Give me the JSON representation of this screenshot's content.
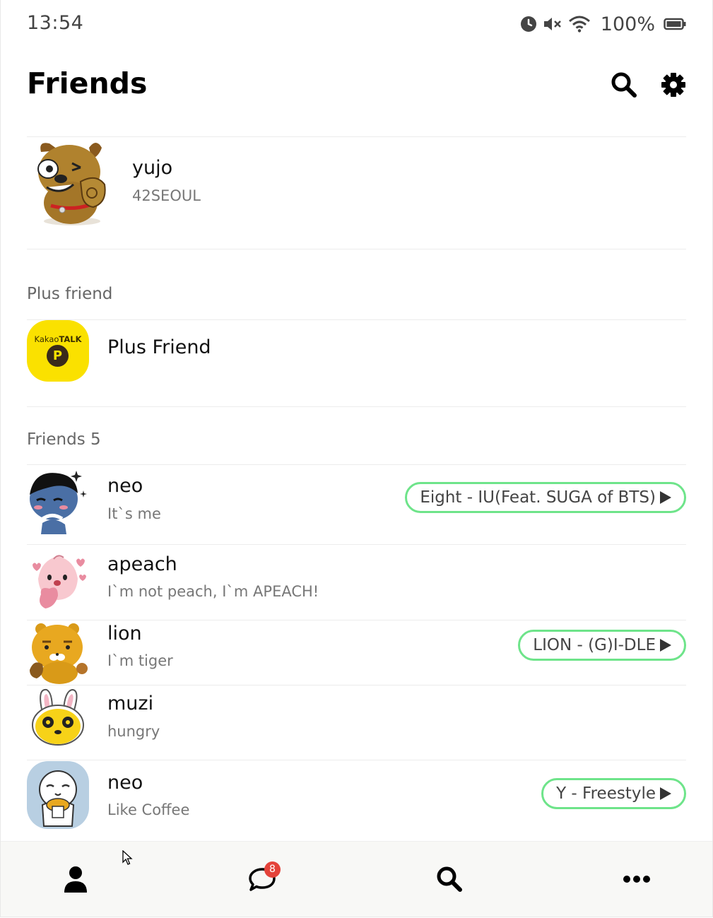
{
  "status_bar": {
    "time": "13:54",
    "battery": "100%"
  },
  "header": {
    "title": "Friends"
  },
  "profile": {
    "name": "yujo",
    "status": "42SEOUL"
  },
  "plus_section": {
    "label": "Plus friend",
    "item": {
      "name": "Plus Friend",
      "logo_text_a": "Kakao",
      "logo_text_b": "TALK",
      "logo_letter": "P"
    }
  },
  "friends_section": {
    "label": "Friends 5",
    "friends": [
      {
        "name": "neo",
        "status": "It`s me",
        "music": "Eight - IU(Feat. SUGA of BTS)"
      },
      {
        "name": "apeach",
        "status": "I`m not peach, I`m APEACH!",
        "music": ""
      },
      {
        "name": "lion",
        "status": "I`m tiger",
        "music": "LION - (G)I-DLE"
      },
      {
        "name": "muzi",
        "status": "hungry",
        "music": ""
      },
      {
        "name": "neo",
        "status": "Like Coffee",
        "music": "Y - Freestyle"
      }
    ]
  },
  "bottom_nav": {
    "chat_badge": "8"
  },
  "colors": {
    "music_border": "#6ee48a",
    "badge": "#e4433a",
    "plus_yellow": "#FAE100"
  }
}
